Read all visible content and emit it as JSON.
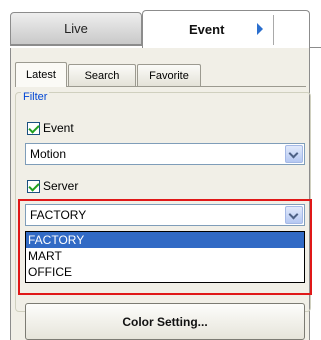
{
  "main_tabs": {
    "live": "Live",
    "event": "Event"
  },
  "sub_tabs": {
    "latest": "Latest",
    "search": "Search",
    "favorite": "Favorite"
  },
  "filter": {
    "legend": "Filter",
    "event_checkbox": {
      "label": "Event",
      "checked": true
    },
    "event_select": {
      "value": "Motion"
    },
    "server_checkbox": {
      "label": "Server",
      "checked": true
    },
    "server_select": {
      "value": "FACTORY",
      "options": [
        "FACTORY",
        "MART",
        "OFFICE"
      ],
      "highlighted": "FACTORY"
    }
  },
  "color_button": "Color Setting...",
  "colors": {
    "highlight_outline": "#e01818",
    "selection": "#316ac5",
    "legend_text": "#0046d5",
    "check_mark": "#21a121",
    "panel_bg": "#f1efe7"
  }
}
